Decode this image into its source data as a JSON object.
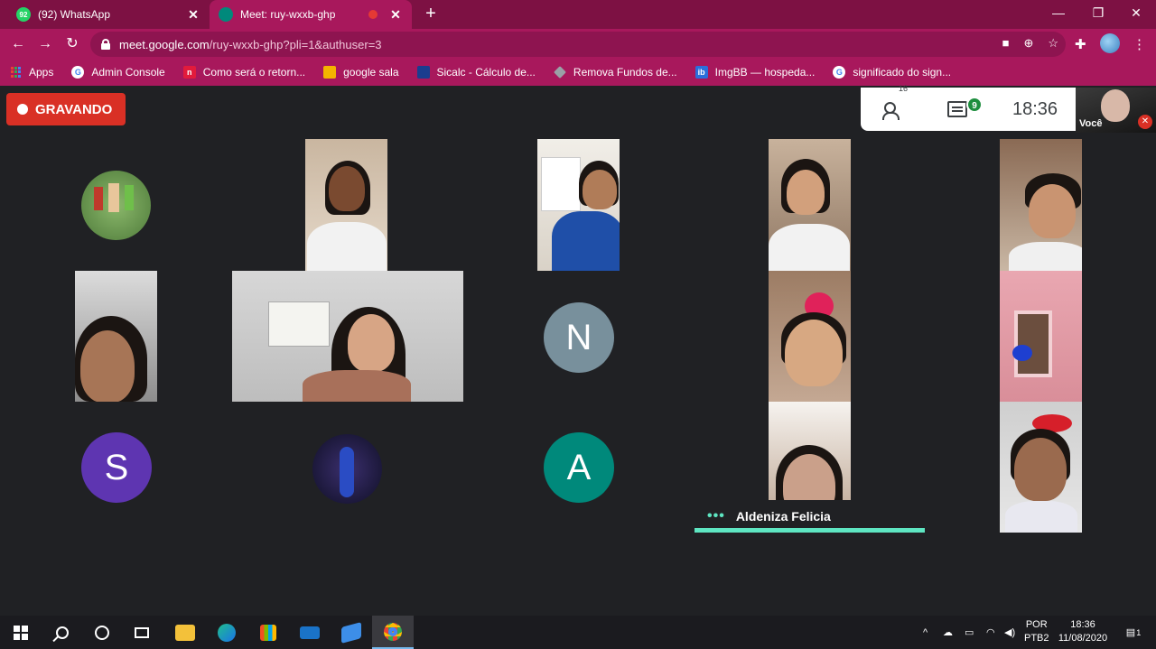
{
  "browser": {
    "tabs": [
      {
        "title": "(92) WhatsApp",
        "badge": "92",
        "color": "#25d366"
      },
      {
        "title": "Meet: ruy-wxxb-ghp",
        "color": "#00897b"
      }
    ],
    "url_host": "meet.google.com",
    "url_path": "/ruy-wxxb-ghp?pli=1&authuser=3",
    "theme_color": "#a8185c",
    "bookmarks": [
      {
        "label": "Apps"
      },
      {
        "label": "Admin Console",
        "icon": "google-icon"
      },
      {
        "label": "Como será o retorn...",
        "icon": "n-icon"
      },
      {
        "label": "google sala",
        "icon": "classroom-icon"
      },
      {
        "label": "Sicalc - Cálculo de...",
        "icon": "sicalc-icon"
      },
      {
        "label": "Remova Fundos de...",
        "icon": "removebg-icon"
      },
      {
        "label": "ImgBB — hospeda...",
        "icon": "imgbb-icon"
      },
      {
        "label": "significado do sign...",
        "icon": "google-icon"
      }
    ]
  },
  "meet": {
    "recording_label": "GRAVANDO",
    "participants_count": "16",
    "chat_count": "9",
    "time": "18:36",
    "self_label": "Você",
    "avatars": [
      {
        "letter": "N",
        "color": "#78909c"
      },
      {
        "letter": "S",
        "color": "#5e35b1"
      },
      {
        "letter": "A",
        "color": "#00897b"
      }
    ],
    "active_speaker": "Aldeniza Felicia",
    "accent_color": "#5ee6c2"
  },
  "taskbar": {
    "lang_top": "POR",
    "lang_bottom": "PTB2",
    "time": "18:36",
    "date": "11/08/2020",
    "notification_count": "1"
  }
}
